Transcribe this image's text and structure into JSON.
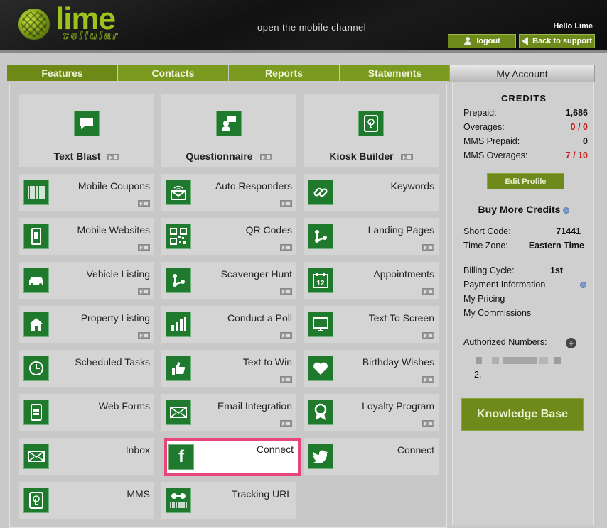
{
  "header": {
    "logo_text": "lime",
    "logo_sub": "cellular",
    "tagline": "open the mobile channel",
    "greeting": "Hello Lime",
    "logout_label": "logout",
    "support_label": "Back to support"
  },
  "nav": {
    "tabs": [
      "Features",
      "Contacts",
      "Reports",
      "Statements"
    ],
    "account_tab": "My Account"
  },
  "features": {
    "big": [
      {
        "label": "Text Blast",
        "icon": "chat-bubble-icon"
      },
      {
        "label": "Questionnaire",
        "icon": "person-speech-icon"
      },
      {
        "label": "Kiosk Builder",
        "icon": "touch-tablet-icon"
      }
    ],
    "rows": [
      [
        "Mobile Coupons",
        "Auto Responders",
        "Keywords"
      ],
      [
        "Mobile Websites",
        "QR Codes",
        "Landing Pages"
      ],
      [
        "Vehicle Listing",
        "Scavenger Hunt",
        "Appointments"
      ],
      [
        "Property Listing",
        "Conduct a Poll",
        "Text To Screen"
      ],
      [
        "Scheduled Tasks",
        "Text to Win",
        "Birthday Wishes"
      ],
      [
        "Web Forms",
        "Email Integration",
        "Loyalty Program"
      ],
      [
        "Inbox",
        "Connect",
        "Connect"
      ],
      [
        "MMS",
        "Tracking URL"
      ]
    ],
    "calendar_day": "12",
    "facebook_glyph": "f"
  },
  "account": {
    "credits_title": "CREDITS",
    "prepaid_label": "Prepaid:",
    "prepaid_value": "1,686",
    "overages_label": "Overages:",
    "overages_value": "0 / 0",
    "mms_prepaid_label": "MMS Prepaid:",
    "mms_prepaid_value": "0",
    "mms_overages_label": "MMS Overages:",
    "mms_overages_value": "7 / 10",
    "edit_profile": "Edit Profile",
    "buy_more": "Buy More Credits",
    "short_code_label": "Short Code:",
    "short_code_value": "71441",
    "time_zone_label": "Time Zone:",
    "time_zone_value": "Eastern Time",
    "billing_cycle_label": "Billing Cycle:",
    "billing_cycle_value": "1st",
    "payment_info": "Payment Information",
    "my_pricing": "My Pricing",
    "my_commissions": "My Commissions",
    "authorized_label": "Authorized Numbers:",
    "authorized_item_2": "2.",
    "knowledge_base": "Knowledge Base"
  },
  "colors": {
    "brand_green": "#6d8a1a",
    "icon_green": "#1f7a2e",
    "highlight_pink": "#e8457a",
    "alert_red": "#c21a1a"
  }
}
